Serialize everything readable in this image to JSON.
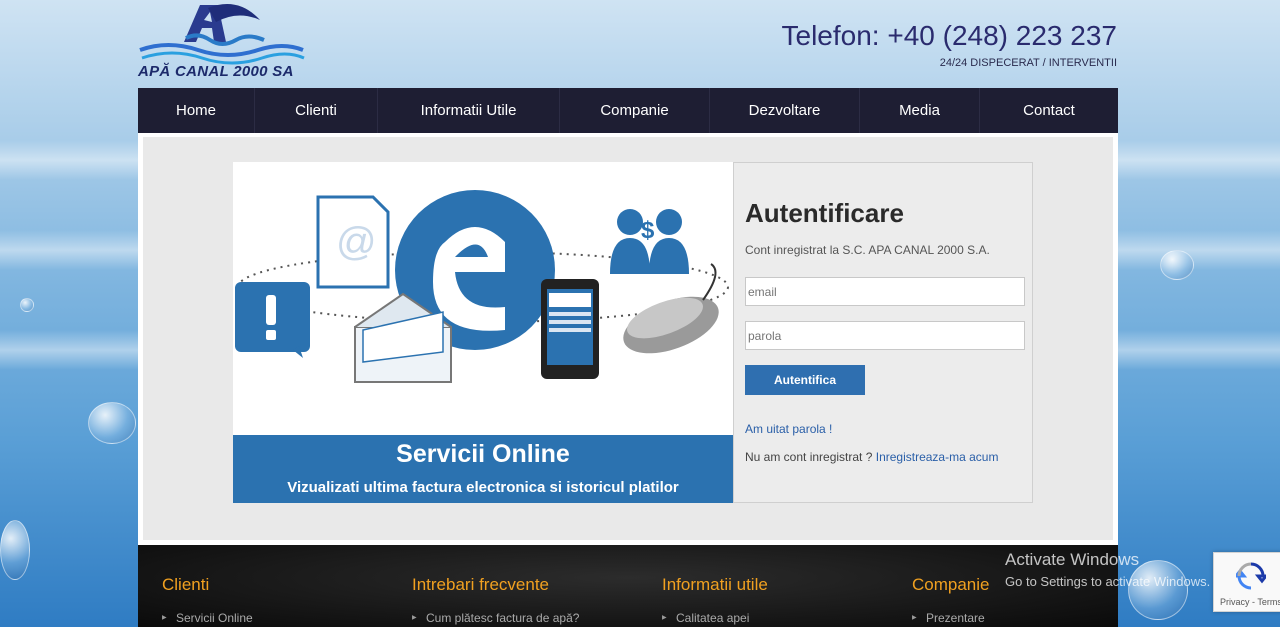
{
  "header": {
    "logo_text": "APĂ CANAL 2000 SA",
    "phone": "Telefon: +40 (248) 223 237",
    "phone_sub": "24/24 DISPECERAT / INTERVENTII"
  },
  "nav": {
    "items": [
      "Home",
      "Clienti",
      "Informatii Utile",
      "Companie",
      "Dezvoltare",
      "Media",
      "Contact"
    ]
  },
  "banner": {
    "title": "Servicii Online",
    "subtitle": "Vizualizati ultima factura electronica si istoricul platilor"
  },
  "login": {
    "title": "Autentificare",
    "description": "Cont inregistrat la S.C. APA CANAL 2000 S.A.",
    "email_placeholder": "email",
    "password_placeholder": "parola",
    "submit_label": "Autentifica",
    "forgot_link": "Am uitat parola !",
    "no_account_text": "Nu am cont inregistrat ?",
    "register_link": "Inregistreaza-ma acum"
  },
  "footer": {
    "columns": [
      {
        "heading": "Clienti",
        "link": "Servicii Online"
      },
      {
        "heading": "Intrebari frecvente",
        "link": "Cum plătesc factura de apă?"
      },
      {
        "heading": "Informatii utile",
        "link": "Calitatea apei"
      },
      {
        "heading": "Companie",
        "link": "Prezentare"
      }
    ]
  },
  "overlay": {
    "windows_title": "Activate Windows",
    "windows_sub": "Go to Settings to activate Windows.",
    "recaptcha_text": "Privacy - Terms"
  },
  "colors": {
    "nav_bg": "#1e1e33",
    "accent_blue": "#2b72b0",
    "footer_heading": "#f0a020"
  },
  "icons": [
    "at-sign-icon",
    "exclamation-icon",
    "e-logo-icon",
    "envelope-icon",
    "phone-icon",
    "users-dollar-icon",
    "mouse-icon",
    "recaptcha-icon"
  ]
}
